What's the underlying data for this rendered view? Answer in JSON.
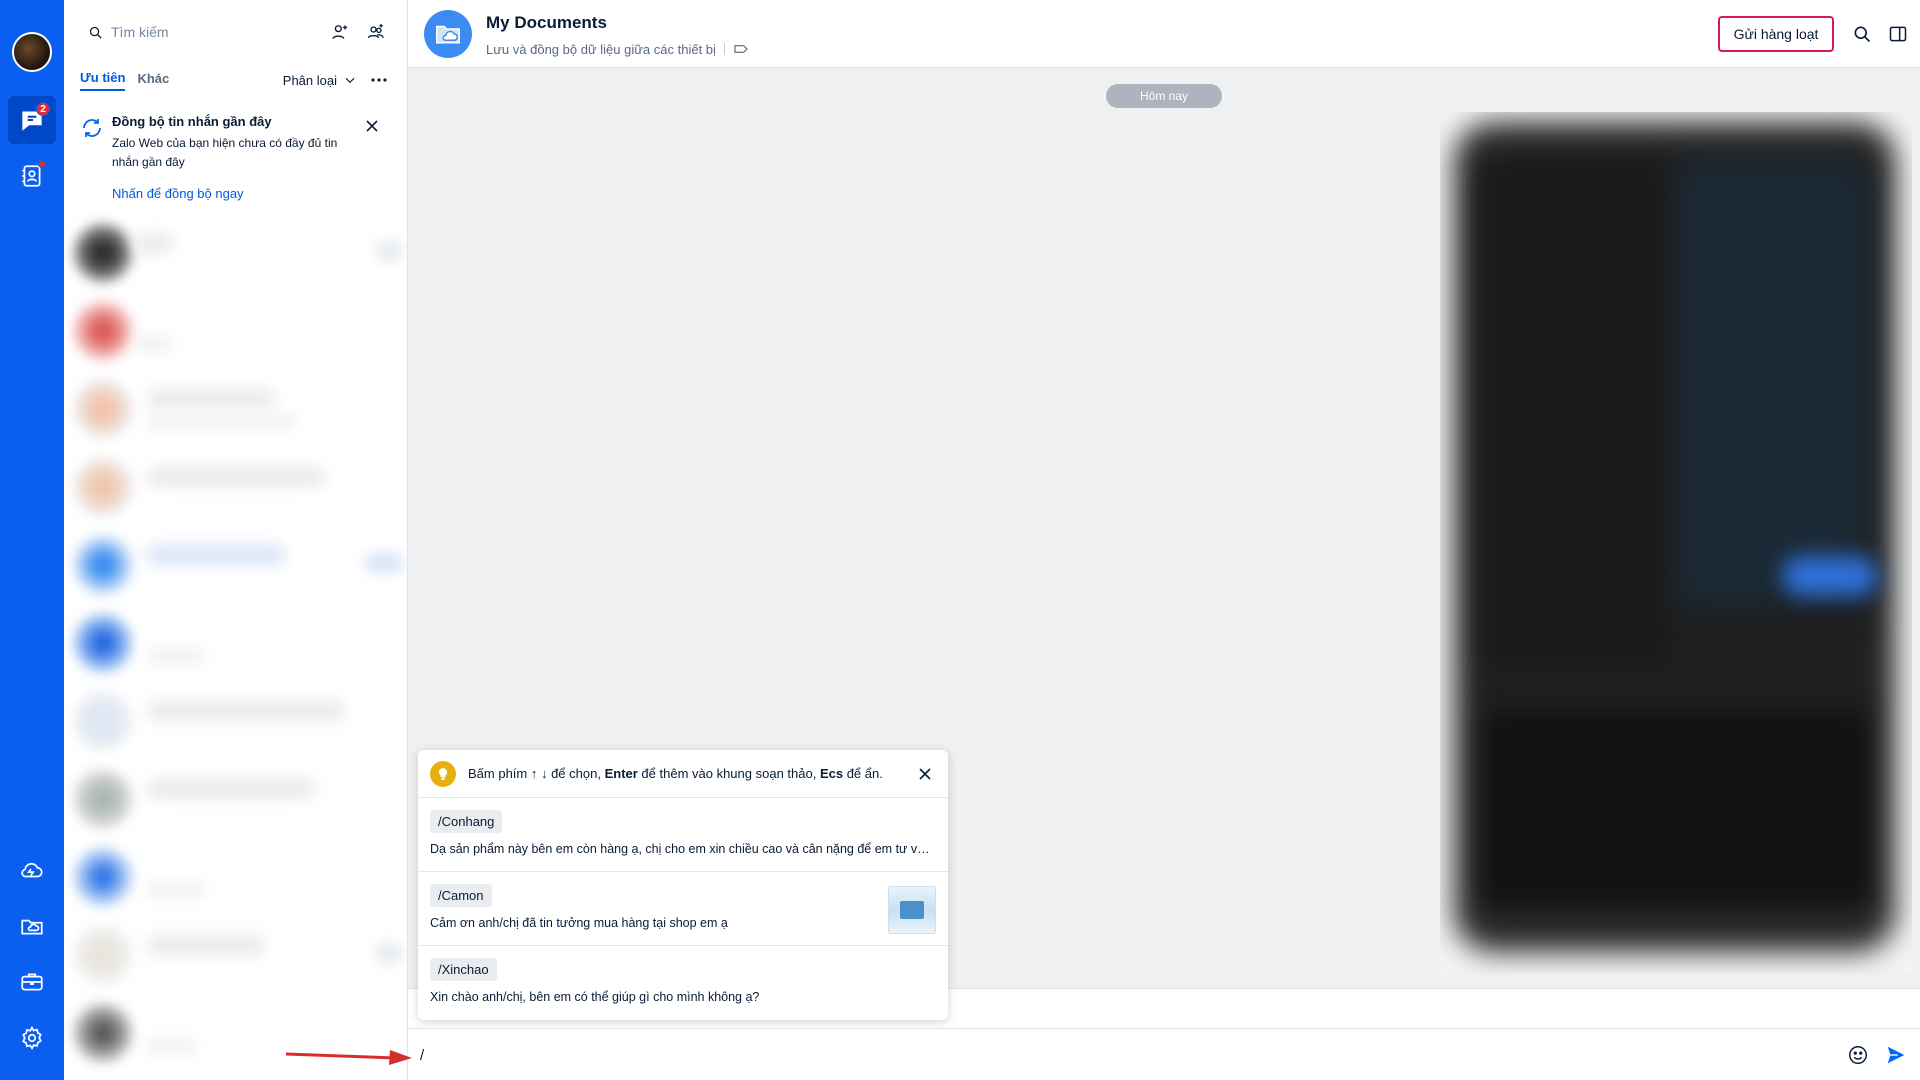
{
  "rail": {
    "chat_badge": "2",
    "icons": [
      "chat-icon",
      "contacts-icon",
      "cloud-icon",
      "folder-cloud-icon",
      "toolbox-icon",
      "settings-icon"
    ]
  },
  "search": {
    "placeholder": "Tìm kiếm"
  },
  "tabs": [
    {
      "label": "Ưu tiên",
      "active": true
    },
    {
      "label": "Khác",
      "active": false
    }
  ],
  "filter": {
    "label": "Phân loại"
  },
  "sync": {
    "title": "Đồng bộ tin nhắn gần đây",
    "description": "Zalo Web của bạn hiện chưa có đầy đủ tin nhắn gần đây",
    "link": "Nhấn để đồng bộ ngay"
  },
  "chat_header": {
    "title": "My Documents",
    "subtitle": "Lưu và đồng bộ dữ liệu giữa các thiết bị",
    "bulk_button": "Gửi hàng loạt"
  },
  "chat": {
    "date_divider": "Hôm nay"
  },
  "quick_reply": {
    "hint_prefix": "Bấm phím ↑ ↓ để chọn, ",
    "hint_enter": "Enter",
    "hint_middle": " để thêm vào khung soạn thảo, ",
    "hint_esc": "Ecs",
    "hint_suffix": " để ẩn.",
    "items": [
      {
        "tag": "/Conhang",
        "text": "Dạ sản phẩm này bên em còn hàng ạ, chị cho em xin chiều cao và cân nặng để em tư vấn size phù hợp nhé ạ"
      },
      {
        "tag": "/Camon",
        "text": "Cảm ơn anh/chị đã tin tưởng mua hàng tại shop em ạ"
      },
      {
        "tag": "/Xinchao",
        "text": "Xin chào anh/chị, bên em có thể giúp gì cho mình không ạ?"
      }
    ]
  },
  "composer": {
    "value": "/"
  },
  "colors": {
    "rail": "#0a5ff0",
    "accent": "#005ae0",
    "bulk_border": "#d5195d",
    "badge": "#e22d2d",
    "hint_bulb": "#e7b010"
  }
}
